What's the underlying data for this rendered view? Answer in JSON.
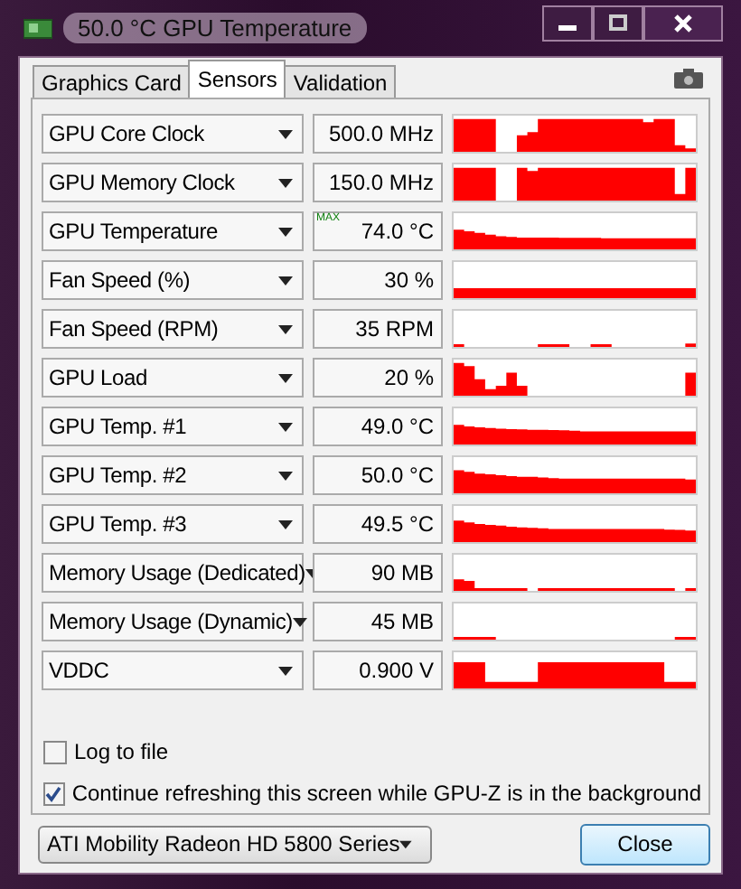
{
  "window": {
    "title": "50.0 °C GPU Temperature"
  },
  "tabs": [
    {
      "label": "Graphics Card",
      "selected": false
    },
    {
      "label": "Sensors",
      "selected": true
    },
    {
      "label": "Validation",
      "selected": false
    }
  ],
  "sensors": [
    {
      "name": "GPU Core Clock",
      "value": "500.0 MHz"
    },
    {
      "name": "GPU Memory Clock",
      "value": "150.0 MHz"
    },
    {
      "name": "GPU Temperature",
      "value": "74.0 °C",
      "tag": "MAX"
    },
    {
      "name": "Fan Speed (%)",
      "value": "30 %"
    },
    {
      "name": "Fan Speed (RPM)",
      "value": "35 RPM"
    },
    {
      "name": "GPU Load",
      "value": "20 %"
    },
    {
      "name": "GPU Temp. #1",
      "value": "49.0 °C"
    },
    {
      "name": "GPU Temp. #2",
      "value": "50.0 °C"
    },
    {
      "name": "GPU Temp. #3",
      "value": "49.5 °C"
    },
    {
      "name": "Memory Usage (Dedicated)",
      "value": "90 MB"
    },
    {
      "name": "Memory Usage (Dynamic)",
      "value": "45 MB"
    },
    {
      "name": "VDDC",
      "value": "0.900 V"
    }
  ],
  "options": [
    {
      "label": "Log to file",
      "checked": false
    },
    {
      "label": "Continue refreshing this screen while GPU-Z is in the background",
      "checked": true
    }
  ],
  "device_select": {
    "value": "ATI Mobility Radeon HD 5800 Series"
  },
  "close_button": {
    "label": "Close"
  }
}
